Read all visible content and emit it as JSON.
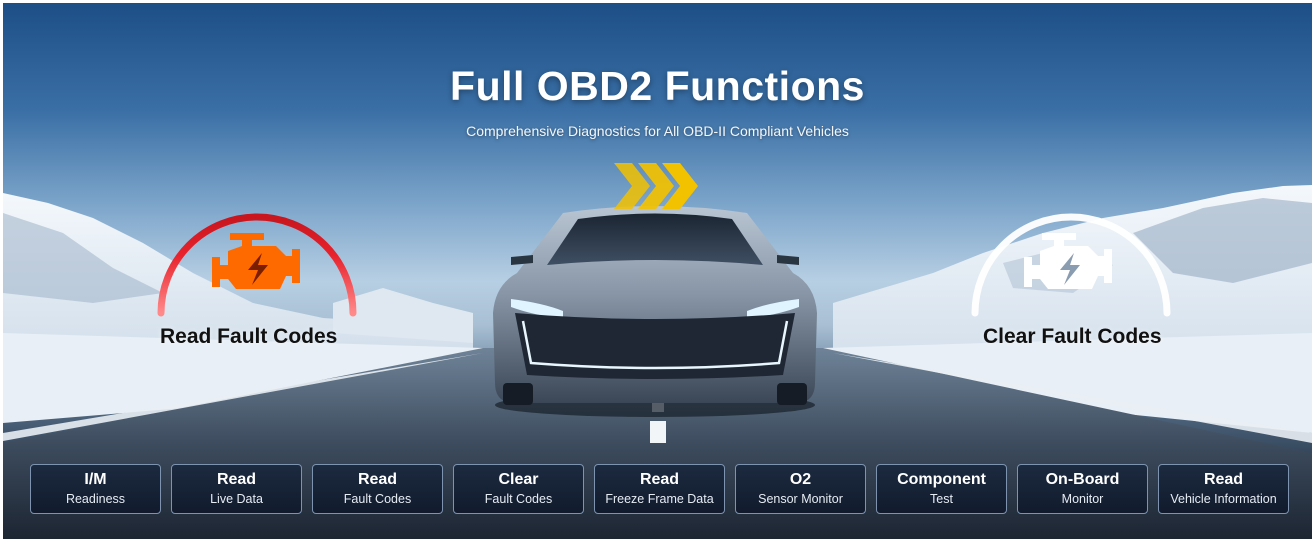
{
  "title": "Full OBD2 Functions",
  "subtitle": "Comprehensive Diagnostics for All OBD-II Compliant Vehicles",
  "left_feature": {
    "label": "Read Fault Codes",
    "icon": "check-engine-icon",
    "color": "#ff6a00"
  },
  "right_feature": {
    "label": "Clear Fault Codes",
    "icon": "check-engine-icon",
    "color": "#ffffff"
  },
  "colors": {
    "accent_orange": "#ff6a00",
    "gauge_red": "#e8222c",
    "chevron_yellow": "#f2c100",
    "chip_bg": "#1a283e"
  },
  "functions": [
    {
      "line1": "I/M",
      "line2": "Readiness"
    },
    {
      "line1": "Read",
      "line2": "Live Data"
    },
    {
      "line1": "Read",
      "line2": "Fault Codes"
    },
    {
      "line1": "Clear",
      "line2": "Fault Codes"
    },
    {
      "line1": "Read",
      "line2": "Freeze Frame Data"
    },
    {
      "line1": "O2",
      "line2": "Sensor Monitor"
    },
    {
      "line1": "Component",
      "line2": "Test"
    },
    {
      "line1": "On-Board",
      "line2": "Monitor"
    },
    {
      "line1": "Read",
      "line2": "Vehicle Information"
    }
  ]
}
